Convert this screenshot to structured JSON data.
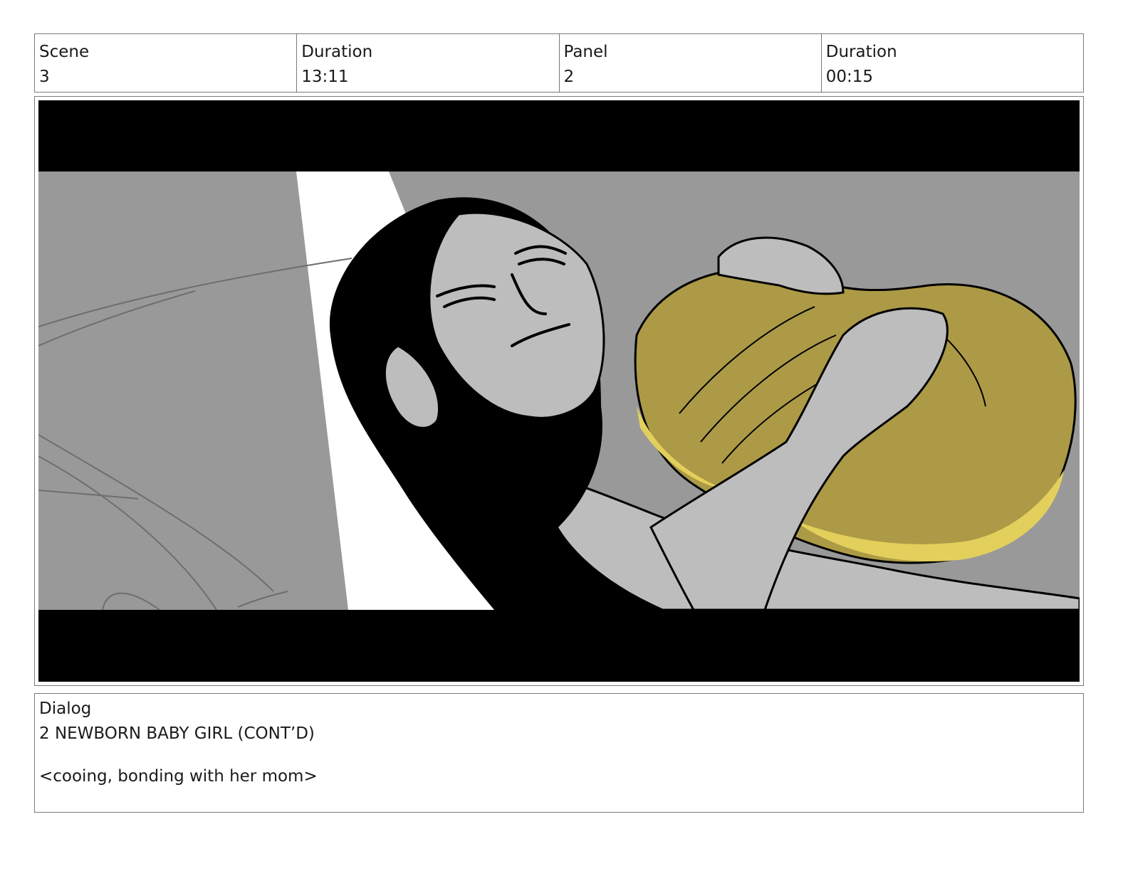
{
  "header": {
    "scene_label": "Scene",
    "scene_value": "3",
    "scene_duration_label": "Duration",
    "scene_duration_value": "13:11",
    "panel_label": "Panel",
    "panel_value": "2",
    "panel_duration_label": "Duration",
    "panel_duration_value": "00:15"
  },
  "panel": {
    "colors": {
      "letterbox": "#000000",
      "background_gray": "#999999",
      "light_beam": "#ffffff",
      "skin_gray": "#bdbdbd",
      "hair": "#000000",
      "blanket_olive": "#ad9a46",
      "blanket_highlight": "#e3d05c"
    }
  },
  "dialog": {
    "label": "Dialog",
    "speaker": "2 NEWBORN BABY GIRL (CONT’D)",
    "line": "<cooing, bonding with her mom>"
  }
}
